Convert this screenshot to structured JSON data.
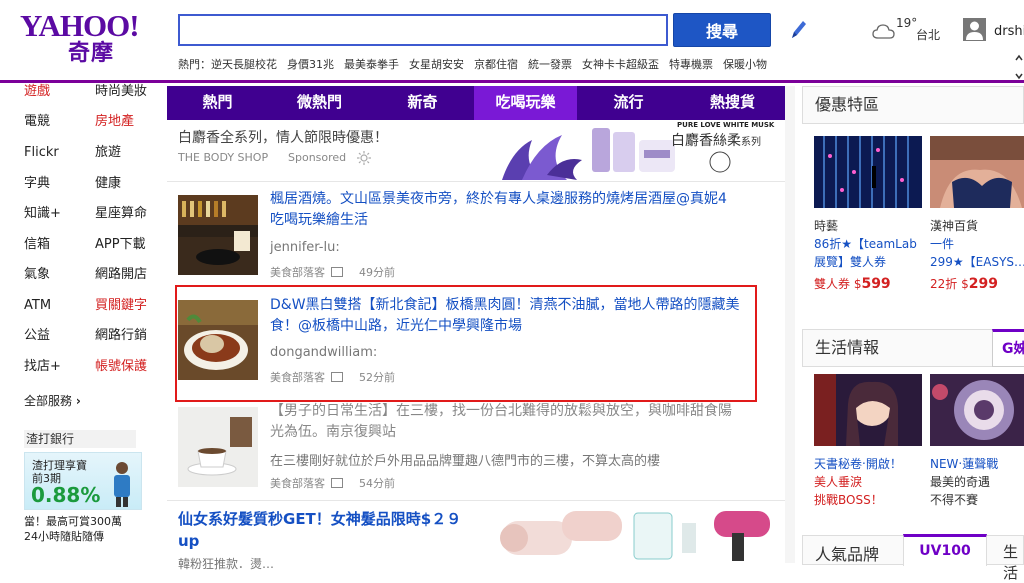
{
  "header": {
    "logo_en": "YAHOO!",
    "logo_zh": "奇摩",
    "search_placeholder": "",
    "search_button": "搜尋",
    "hot_label": "熱門：",
    "hot_keywords": [
      "逆天長腿校花",
      "身價31兆",
      "最美泰拳手",
      "女星胡安安",
      "京都住宿",
      "統一發票",
      "女神卡卡超級盃",
      "特專機票",
      "保暖小物"
    ],
    "weather_temp": "19°",
    "weather_city": "台北",
    "username": "drshin"
  },
  "left_nav": {
    "col1": [
      "遊戲",
      "電競",
      "Flickr",
      "字典",
      "知識+",
      "信箱",
      "氣象",
      "ATM",
      "公益",
      "找店+"
    ],
    "col2": [
      "時尚美妝",
      "房地產",
      "旅遊",
      "健康",
      "星座算命",
      "APP下載",
      "網路開店",
      "買關鍵字",
      "網路行銷",
      "帳號保護"
    ],
    "more_services": "全部服務",
    "bank_title": "渣打銀行",
    "bank_ad_line1": "渣打理享寶",
    "bank_ad_line2": "前3期",
    "bank_ad_rate": "0.88%",
    "bank_note_line1": "當！最高可賞300萬",
    "bank_note_line2": "24小時隨貼隨傳"
  },
  "tabs": [
    "熱門",
    "微熱門",
    "新奇",
    "吃喝玩樂",
    "流行",
    "熱搜貨"
  ],
  "active_tab": "吃喝玩樂",
  "sponsored": {
    "title": "白麝香全系列，情人節限時優惠！",
    "brand": "THE BODY SHOP",
    "tag": "Sponsored",
    "ad_tag": "PURE LOVE WHITE MUSK",
    "ad_name": "白麝香絲柔",
    "ad_name_suffix": "系列"
  },
  "feed": [
    {
      "title": "楓居酒燒。文山區景美夜市旁，終於有專人桌邊服務的燒烤居酒屋@真妮4吃喝玩樂繪生活",
      "author": "jennifer-lu:",
      "source": "美食部落客",
      "time": "49分前"
    },
    {
      "title": "D&W黑白雙搭【新北食記】板橋黑肉圓！清燕不油膩，當地人帶路的隱藏美食！@板橋中山路，近光仁中學興隆市場",
      "author": "dongandwilliam:",
      "source": "美食部落客",
      "time": "52分前"
    },
    {
      "title": "【男子的日常生活】在三樓，找一份台北難得的放鬆與放空，與咖啡甜食陽光為伍。南京復興站",
      "author": "在三樓剛好就位於戶外用品品牌璽趣八德門市的三樓，不算太高的樓",
      "source": "美食部落客",
      "time": "54分前"
    }
  ],
  "bottom_ad": {
    "title": "仙女系好髮質秒GET！女神髮品限時$２９up",
    "sub": "韓粉狂推款．燙…"
  },
  "right": {
    "deals_title": "優惠特區",
    "deals": [
      {
        "shop": "時藝",
        "line1": "86折★【teamLab",
        "line2": "展覽】雙人券",
        "price_label": "雙人券 $",
        "price": "599"
      },
      {
        "shop": "漢神百貨",
        "line1": "一件",
        "line2": "299★【EASYS…",
        "price_label": "22折 $",
        "price": "299"
      }
    ],
    "life_title": "生活情報",
    "life_tab": "G姊",
    "life": [
      {
        "line1": "天書秘卷‧開啟！",
        "line2": "美人垂淚",
        "line3": "挑戰BOSS！"
      },
      {
        "line1": "NEW‧蓮聲戰",
        "line2": "最美的奇遇",
        "line3": "不得不賽"
      }
    ],
    "popular_title": "人氣品牌",
    "popular_tab": "UV100",
    "popular_more": "生活"
  },
  "colors": {
    "brand_purple": "#400090",
    "active_tab": "#7a19d6",
    "link_blue": "#1550c3",
    "alert_red": "#d32121",
    "search_btn": "#1e56c5"
  }
}
